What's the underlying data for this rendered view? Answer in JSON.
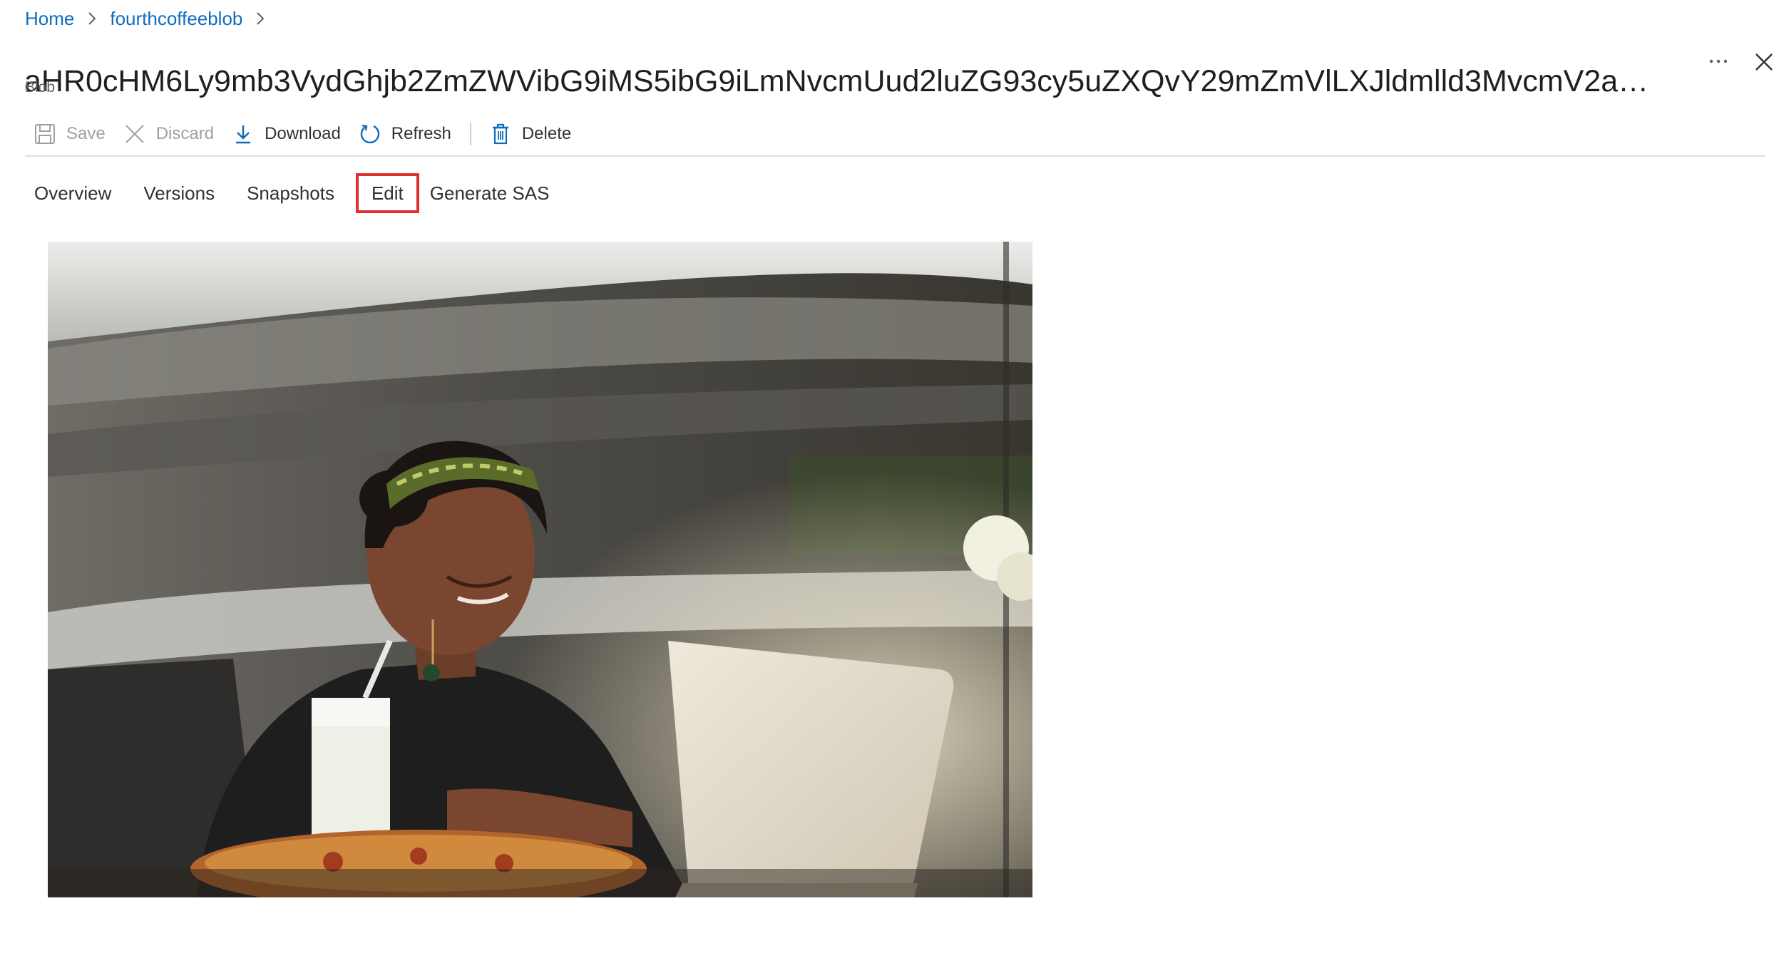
{
  "breadcrumb": {
    "items": [
      {
        "label": "Home"
      },
      {
        "label": "fourthcoffeeblob"
      }
    ]
  },
  "header": {
    "title": "aHR0cHM6Ly9mb3VydGhjb2ZmZWVibG9iMS5ibG9iLmNvcmUud2luZG93cy5uZXQvY29mZmVlLXJldmlld3MvcmV2aW…",
    "subtitle": "Blob",
    "more_icon": "ellipsis-icon",
    "close_icon": "close-icon"
  },
  "toolbar": {
    "save_label": "Save",
    "discard_label": "Discard",
    "download_label": "Download",
    "refresh_label": "Refresh",
    "delete_label": "Delete"
  },
  "tabs": [
    {
      "label": "Overview"
    },
    {
      "label": "Versions"
    },
    {
      "label": "Snapshots"
    },
    {
      "label": "Edit",
      "highlighted": true
    },
    {
      "label": "Generate SAS"
    }
  ],
  "colors": {
    "link": "#0f6cbd",
    "highlight_border": "#e0312f",
    "disabled_text": "#a19f9d"
  }
}
